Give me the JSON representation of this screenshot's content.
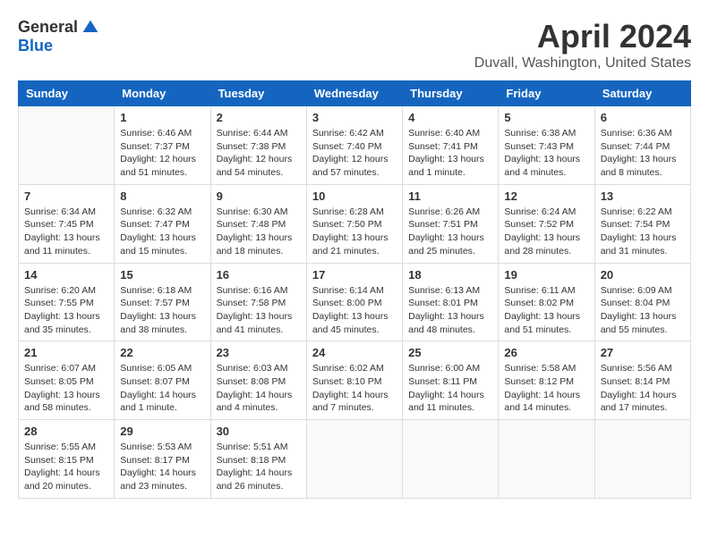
{
  "logo": {
    "general": "General",
    "blue": "Blue"
  },
  "title": "April 2024",
  "location": "Duvall, Washington, United States",
  "days_of_week": [
    "Sunday",
    "Monday",
    "Tuesday",
    "Wednesday",
    "Thursday",
    "Friday",
    "Saturday"
  ],
  "weeks": [
    [
      {
        "day": "",
        "sunrise": "",
        "sunset": "",
        "daylight": ""
      },
      {
        "day": "1",
        "sunrise": "Sunrise: 6:46 AM",
        "sunset": "Sunset: 7:37 PM",
        "daylight": "Daylight: 12 hours and 51 minutes."
      },
      {
        "day": "2",
        "sunrise": "Sunrise: 6:44 AM",
        "sunset": "Sunset: 7:38 PM",
        "daylight": "Daylight: 12 hours and 54 minutes."
      },
      {
        "day": "3",
        "sunrise": "Sunrise: 6:42 AM",
        "sunset": "Sunset: 7:40 PM",
        "daylight": "Daylight: 12 hours and 57 minutes."
      },
      {
        "day": "4",
        "sunrise": "Sunrise: 6:40 AM",
        "sunset": "Sunset: 7:41 PM",
        "daylight": "Daylight: 13 hours and 1 minute."
      },
      {
        "day": "5",
        "sunrise": "Sunrise: 6:38 AM",
        "sunset": "Sunset: 7:43 PM",
        "daylight": "Daylight: 13 hours and 4 minutes."
      },
      {
        "day": "6",
        "sunrise": "Sunrise: 6:36 AM",
        "sunset": "Sunset: 7:44 PM",
        "daylight": "Daylight: 13 hours and 8 minutes."
      }
    ],
    [
      {
        "day": "7",
        "sunrise": "Sunrise: 6:34 AM",
        "sunset": "Sunset: 7:45 PM",
        "daylight": "Daylight: 13 hours and 11 minutes."
      },
      {
        "day": "8",
        "sunrise": "Sunrise: 6:32 AM",
        "sunset": "Sunset: 7:47 PM",
        "daylight": "Daylight: 13 hours and 15 minutes."
      },
      {
        "day": "9",
        "sunrise": "Sunrise: 6:30 AM",
        "sunset": "Sunset: 7:48 PM",
        "daylight": "Daylight: 13 hours and 18 minutes."
      },
      {
        "day": "10",
        "sunrise": "Sunrise: 6:28 AM",
        "sunset": "Sunset: 7:50 PM",
        "daylight": "Daylight: 13 hours and 21 minutes."
      },
      {
        "day": "11",
        "sunrise": "Sunrise: 6:26 AM",
        "sunset": "Sunset: 7:51 PM",
        "daylight": "Daylight: 13 hours and 25 minutes."
      },
      {
        "day": "12",
        "sunrise": "Sunrise: 6:24 AM",
        "sunset": "Sunset: 7:52 PM",
        "daylight": "Daylight: 13 hours and 28 minutes."
      },
      {
        "day": "13",
        "sunrise": "Sunrise: 6:22 AM",
        "sunset": "Sunset: 7:54 PM",
        "daylight": "Daylight: 13 hours and 31 minutes."
      }
    ],
    [
      {
        "day": "14",
        "sunrise": "Sunrise: 6:20 AM",
        "sunset": "Sunset: 7:55 PM",
        "daylight": "Daylight: 13 hours and 35 minutes."
      },
      {
        "day": "15",
        "sunrise": "Sunrise: 6:18 AM",
        "sunset": "Sunset: 7:57 PM",
        "daylight": "Daylight: 13 hours and 38 minutes."
      },
      {
        "day": "16",
        "sunrise": "Sunrise: 6:16 AM",
        "sunset": "Sunset: 7:58 PM",
        "daylight": "Daylight: 13 hours and 41 minutes."
      },
      {
        "day": "17",
        "sunrise": "Sunrise: 6:14 AM",
        "sunset": "Sunset: 8:00 PM",
        "daylight": "Daylight: 13 hours and 45 minutes."
      },
      {
        "day": "18",
        "sunrise": "Sunrise: 6:13 AM",
        "sunset": "Sunset: 8:01 PM",
        "daylight": "Daylight: 13 hours and 48 minutes."
      },
      {
        "day": "19",
        "sunrise": "Sunrise: 6:11 AM",
        "sunset": "Sunset: 8:02 PM",
        "daylight": "Daylight: 13 hours and 51 minutes."
      },
      {
        "day": "20",
        "sunrise": "Sunrise: 6:09 AM",
        "sunset": "Sunset: 8:04 PM",
        "daylight": "Daylight: 13 hours and 55 minutes."
      }
    ],
    [
      {
        "day": "21",
        "sunrise": "Sunrise: 6:07 AM",
        "sunset": "Sunset: 8:05 PM",
        "daylight": "Daylight: 13 hours and 58 minutes."
      },
      {
        "day": "22",
        "sunrise": "Sunrise: 6:05 AM",
        "sunset": "Sunset: 8:07 PM",
        "daylight": "Daylight: 14 hours and 1 minute."
      },
      {
        "day": "23",
        "sunrise": "Sunrise: 6:03 AM",
        "sunset": "Sunset: 8:08 PM",
        "daylight": "Daylight: 14 hours and 4 minutes."
      },
      {
        "day": "24",
        "sunrise": "Sunrise: 6:02 AM",
        "sunset": "Sunset: 8:10 PM",
        "daylight": "Daylight: 14 hours and 7 minutes."
      },
      {
        "day": "25",
        "sunrise": "Sunrise: 6:00 AM",
        "sunset": "Sunset: 8:11 PM",
        "daylight": "Daylight: 14 hours and 11 minutes."
      },
      {
        "day": "26",
        "sunrise": "Sunrise: 5:58 AM",
        "sunset": "Sunset: 8:12 PM",
        "daylight": "Daylight: 14 hours and 14 minutes."
      },
      {
        "day": "27",
        "sunrise": "Sunrise: 5:56 AM",
        "sunset": "Sunset: 8:14 PM",
        "daylight": "Daylight: 14 hours and 17 minutes."
      }
    ],
    [
      {
        "day": "28",
        "sunrise": "Sunrise: 5:55 AM",
        "sunset": "Sunset: 8:15 PM",
        "daylight": "Daylight: 14 hours and 20 minutes."
      },
      {
        "day": "29",
        "sunrise": "Sunrise: 5:53 AM",
        "sunset": "Sunset: 8:17 PM",
        "daylight": "Daylight: 14 hours and 23 minutes."
      },
      {
        "day": "30",
        "sunrise": "Sunrise: 5:51 AM",
        "sunset": "Sunset: 8:18 PM",
        "daylight": "Daylight: 14 hours and 26 minutes."
      },
      {
        "day": "",
        "sunrise": "",
        "sunset": "",
        "daylight": ""
      },
      {
        "day": "",
        "sunrise": "",
        "sunset": "",
        "daylight": ""
      },
      {
        "day": "",
        "sunrise": "",
        "sunset": "",
        "daylight": ""
      },
      {
        "day": "",
        "sunrise": "",
        "sunset": "",
        "daylight": ""
      }
    ]
  ]
}
